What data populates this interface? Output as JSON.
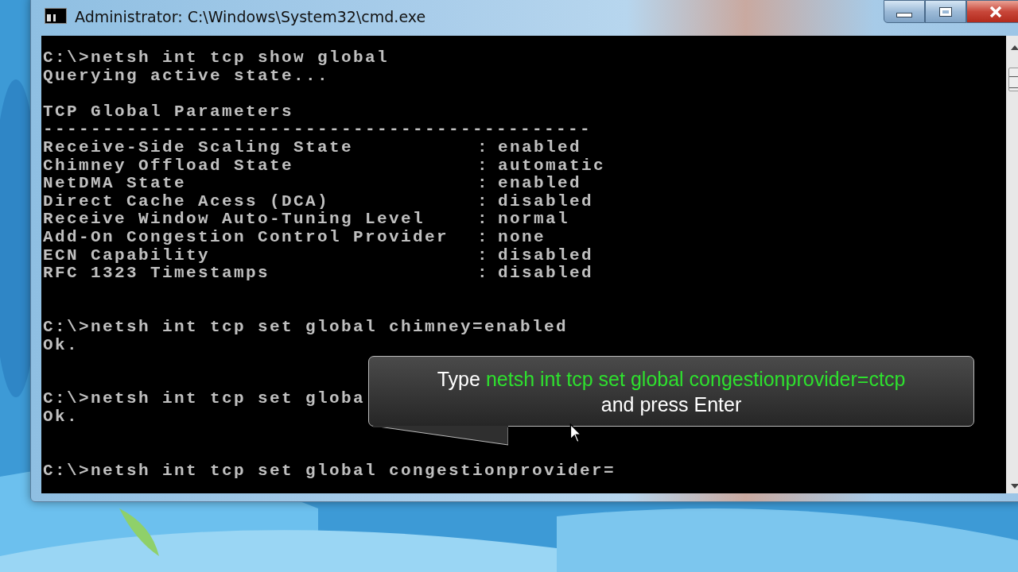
{
  "window": {
    "title": "Administrator: C:\\Windows\\System32\\cmd.exe"
  },
  "console": {
    "lines": [
      {
        "kind": "text",
        "text": "C:\\>netsh int tcp show global"
      },
      {
        "kind": "text",
        "text": "Querying active state..."
      },
      {
        "kind": "blank"
      },
      {
        "kind": "text",
        "text": "TCP Global Parameters"
      },
      {
        "kind": "text",
        "text": "----------------------------------------------"
      },
      {
        "kind": "param",
        "name": "Receive-Side Scaling State",
        "separator": ":",
        "value": "enabled"
      },
      {
        "kind": "param",
        "name": "Chimney Offload State",
        "separator": ":",
        "value": "automatic"
      },
      {
        "kind": "param",
        "name": "NetDMA State",
        "separator": ":",
        "value": "enabled"
      },
      {
        "kind": "param",
        "name": "Direct Cache Acess (DCA)",
        "separator": ":",
        "value": "disabled"
      },
      {
        "kind": "param",
        "name": "Receive Window Auto-Tuning Level",
        "separator": ":",
        "value": "normal"
      },
      {
        "kind": "param",
        "name": "Add-On Congestion Control Provider",
        "separator": ":",
        "value": "none"
      },
      {
        "kind": "param",
        "name": "ECN Capability",
        "separator": ":",
        "value": "disabled"
      },
      {
        "kind": "param",
        "name": "RFC 1323 Timestamps",
        "separator": ":",
        "value": "disabled"
      },
      {
        "kind": "blank"
      },
      {
        "kind": "blank"
      },
      {
        "kind": "text",
        "text": "C:\\>netsh int tcp set global chimney=enabled"
      },
      {
        "kind": "text",
        "text": "Ok."
      },
      {
        "kind": "blank"
      },
      {
        "kind": "blank"
      },
      {
        "kind": "text",
        "text": "C:\\>netsh int tcp set globa"
      },
      {
        "kind": "text",
        "text": "Ok."
      },
      {
        "kind": "blank"
      },
      {
        "kind": "blank"
      },
      {
        "kind": "text",
        "text": "C:\\>netsh int tcp set global congestionprovider="
      }
    ]
  },
  "callout": {
    "lines": [
      {
        "segments": [
          {
            "kind": "plain",
            "text": "Type "
          },
          {
            "kind": "command",
            "text": "netsh int tcp set global congestionprovider=ctcp"
          }
        ]
      },
      {
        "segments": [
          {
            "kind": "plain",
            "text": "and press Enter"
          }
        ]
      }
    ]
  }
}
